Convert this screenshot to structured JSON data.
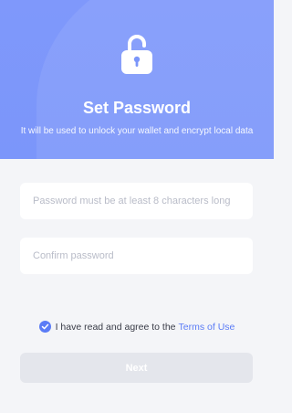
{
  "header": {
    "title": "Set Password",
    "subtitle": "It will be used to unlock your wallet and encrypt local data",
    "icon": "unlocked-padlock-icon",
    "background_color": "#7b96fa"
  },
  "form": {
    "password_placeholder": "Password must be at least 8 characters long",
    "password_value": "",
    "confirm_placeholder": "Confirm password",
    "confirm_value": "",
    "agree_checked": true,
    "agree_text": "I have read and agree to the",
    "terms_link": "Terms of Use",
    "accent_color": "#5b7cf6"
  },
  "actions": {
    "next_label": "Next",
    "next_enabled": false
  }
}
